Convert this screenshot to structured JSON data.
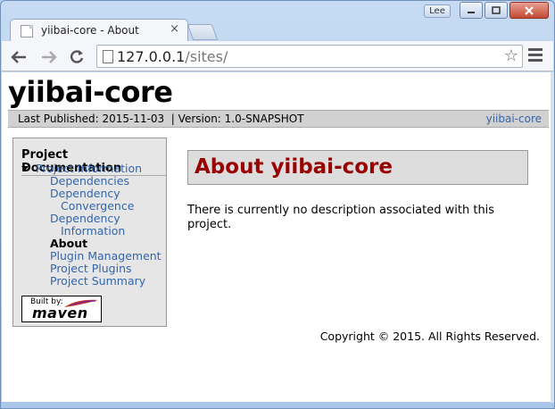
{
  "window": {
    "user_badge": "Lee",
    "accent": "#c24a32"
  },
  "tab": {
    "title": "yiibai-core - About",
    "close": "×"
  },
  "toolbar": {
    "url_host": "127.0.0.1",
    "url_path": "/sites/",
    "bookmark_icon": "star-icon"
  },
  "page": {
    "banner": "yiibai-core",
    "breadcrumb_left": "Last Published: 2015-11-03  | Version: 1.0-SNAPSHOT",
    "breadcrumb_right": "yiibai-core",
    "link_color": "#3366aa",
    "heading_color": "#990000",
    "menu": {
      "title": "Project Documentation",
      "items": [
        {
          "label": "Project Information",
          "level": 0
        },
        {
          "label": "Dependencies",
          "level": 1
        },
        {
          "label": "Dependency",
          "level": 1
        },
        {
          "label": "Convergence",
          "level": 2
        },
        {
          "label": "Dependency",
          "level": 1
        },
        {
          "label": "Information",
          "level": 2
        },
        {
          "label": "About",
          "level": 1
        },
        {
          "label": "Plugin Management",
          "level": 1
        },
        {
          "label": "Project Plugins",
          "level": 1
        },
        {
          "label": "Project Summary",
          "level": 1
        }
      ]
    },
    "logo": {
      "built_by": "Built by:",
      "name": "maven"
    },
    "section_title": "About yiibai-core",
    "description": "There is currently no description associated with this project.",
    "copyright": "Copyright © 2015. All Rights Reserved."
  }
}
